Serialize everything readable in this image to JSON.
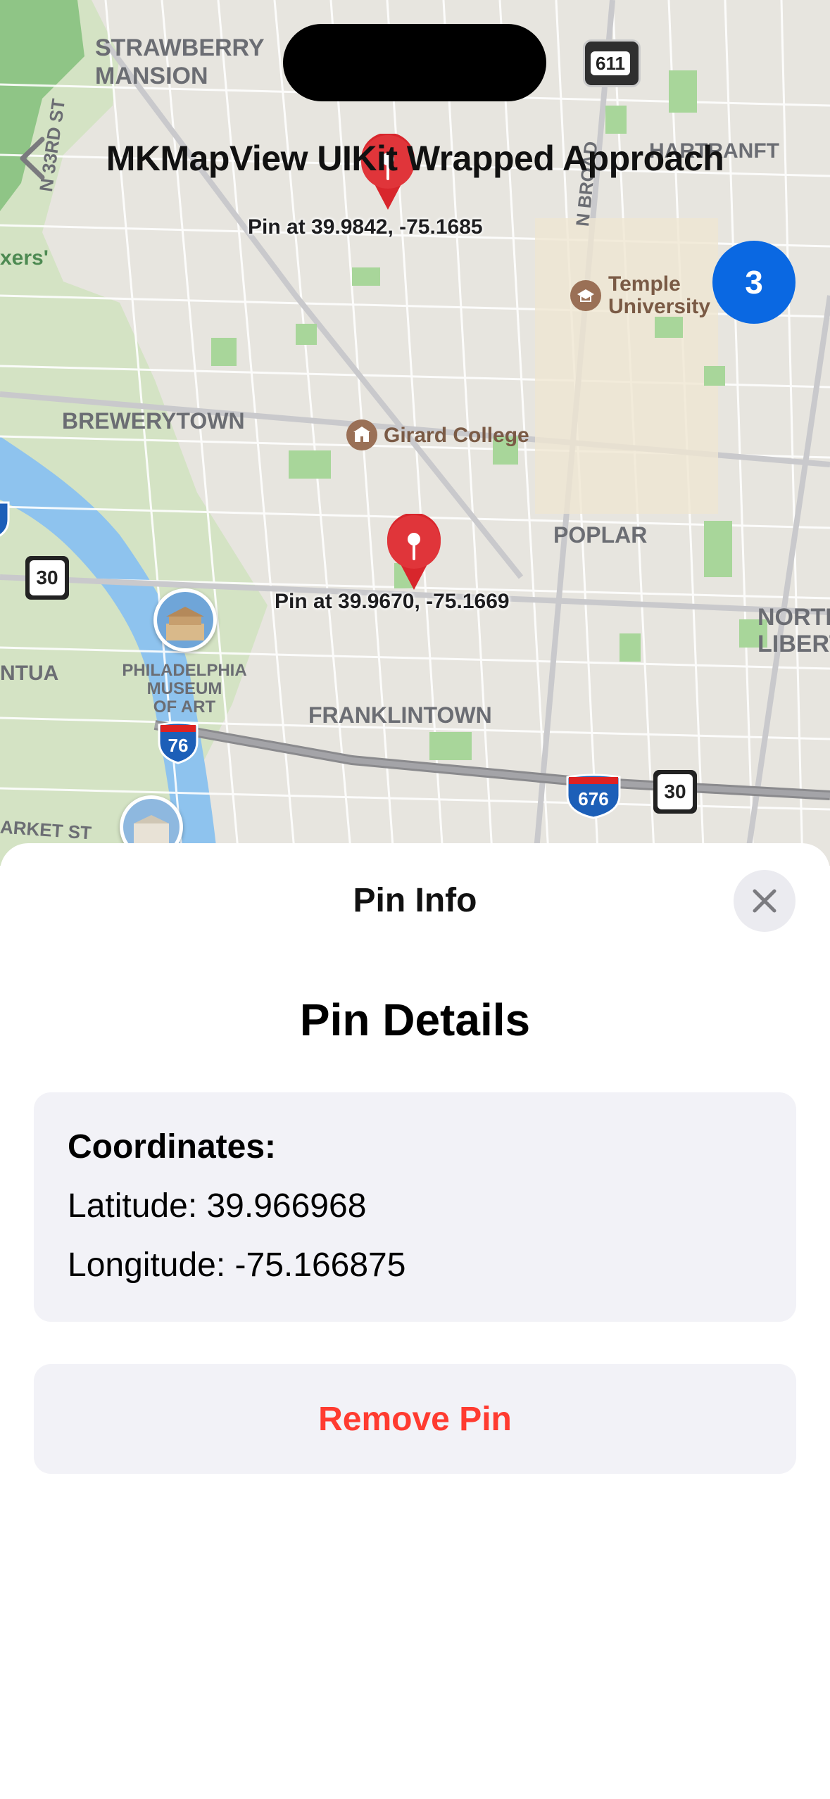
{
  "nav": {
    "title": "MKMapView UIKit Wrapped Approach"
  },
  "map": {
    "pins": [
      {
        "label": "Pin at 39.9842, -75.1685"
      },
      {
        "label": "Pin at 39.9670, -75.1669"
      }
    ],
    "cluster_count": "3",
    "neighborhoods": {
      "strawberry_line1": "STRAWBERRY",
      "strawberry_line2": "MANSION",
      "brewerytown": "BREWERYTOWN",
      "poplar": "POPLAR",
      "franklintown": "FRANKLINTOWN",
      "north_line1": "NORTH",
      "north_line2": "LIBERT",
      "ntua": "NTUA",
      "hartranft": "HARTRANFT",
      "xers": "xers'"
    },
    "streets": {
      "n33rd": "N 33RD ST",
      "nbroad": "N BROAD",
      "market": "ARKET ST"
    },
    "pois": {
      "temple_line1": "Temple",
      "temple_line2": "University",
      "girard": "Girard College",
      "museum_line1": "PHILADELPHIA",
      "museum_line2": "MUSEUM",
      "museum_line3": "OF ART"
    },
    "shields": {
      "pa611": "611",
      "us30_a": "30",
      "us30_b": "30",
      "i76": "76",
      "i676": "676"
    }
  },
  "sheet": {
    "title": "Pin Info",
    "heading": "Pin Details",
    "coordinates_label": "Coordinates:",
    "latitude": "Latitude: 39.966968",
    "longitude": "Longitude: -75.166875",
    "remove_label": "Remove Pin"
  },
  "colors": {
    "accent_blue": "#0a68e2",
    "destructive_red": "#ff3b30",
    "pin_red": "#d8262c",
    "card_bg": "#f2f2f7"
  }
}
